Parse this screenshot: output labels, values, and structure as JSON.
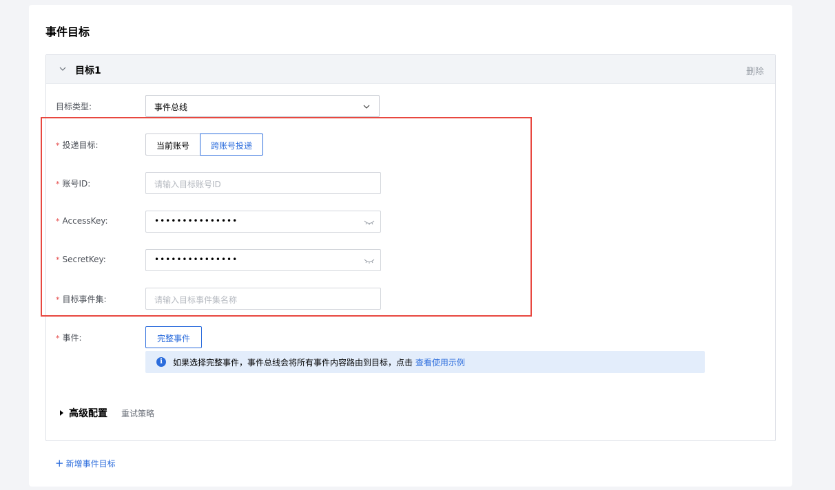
{
  "section": {
    "title": "事件目标"
  },
  "target": {
    "title": "目标1",
    "delete_label": "删除",
    "type_label": "目标类型:",
    "type_value": "事件总线",
    "delivery_label": "投递目标:",
    "delivery_options": [
      "当前账号",
      "跨账号投递"
    ],
    "delivery_selected": "跨账号投递",
    "account_label": "账号ID:",
    "account_placeholder": "请输入目标账号ID",
    "accesskey_label": "AccessKey:",
    "accesskey_value": "•••••••••••••••",
    "secretkey_label": "SecretKey:",
    "secretkey_value": "•••••••••••••••",
    "eventset_label": "目标事件集:",
    "eventset_placeholder": "请输入目标事件集名称",
    "event_label": "事件:",
    "event_button": "完整事件",
    "info_text": "如果选择完整事件，事件总线会将所有事件内容路由到目标，点击",
    "info_link": "查看使用示例",
    "required_mark": "*",
    "advanced_label": "高级配置",
    "advanced_sub": "重试策略"
  },
  "add_target": {
    "plus": "+",
    "label": "新增事件目标"
  },
  "colors": {
    "accent": "#2b6cdc",
    "highlight": "#e8473f",
    "required": "#e54545"
  }
}
